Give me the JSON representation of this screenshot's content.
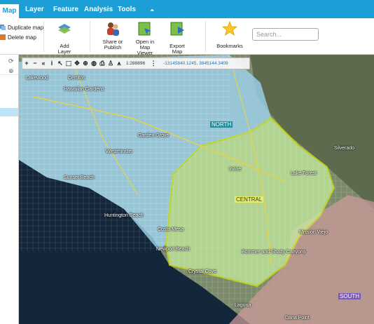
{
  "tabs": [
    "Map",
    "Layer",
    "Feature",
    "Analysis",
    "Tools"
  ],
  "tab_collapse": "⏶",
  "ribbon": {
    "duplicate_map": "Duplicate map",
    "delete_map": "Delete map",
    "add_layer": "Add Layer",
    "share_1": "Share or",
    "share_2": "Publish",
    "open_1": "Open in",
    "open_2": "Map Viewer",
    "export_map": "Export Map",
    "bookmarks": "Bookmarks",
    "search_placeholder": "Search..."
  },
  "map": {
    "scale": "1:288896",
    "coordinates": "-13145840.1245, 3845144.3409",
    "zones": {
      "north": "NORTH",
      "central": "CENTRAL",
      "south": "SOUTH"
    },
    "places": {
      "cerritos": "Cerritos",
      "lakewood": "Lakewood",
      "hawaiian_gardens": "Hawaiian Gardens",
      "huntington_beach": "Huntington Beach",
      "sunset_beach": "Sunset Beach",
      "costa_mesa": "Costa Mesa",
      "newport_beach": "Newport Beach",
      "crystal_cove": "Crystal Cove",
      "laguna": "Laguna",
      "lake_forest": "Lake Forest",
      "mission_viejo": "Mission Viejo",
      "dana_point": "Dana Point",
      "silverado": "Silverado",
      "irvine": "Irvine",
      "westminster": "Westminster",
      "garden_grove": "Garden Grove",
      "bommer": "Bommer and Shady Canyons"
    },
    "colors": {
      "north": "#9fd6f3",
      "central": "#c8f0a0",
      "central_border": "#d4e600",
      "south": "#d8a6a6"
    }
  }
}
